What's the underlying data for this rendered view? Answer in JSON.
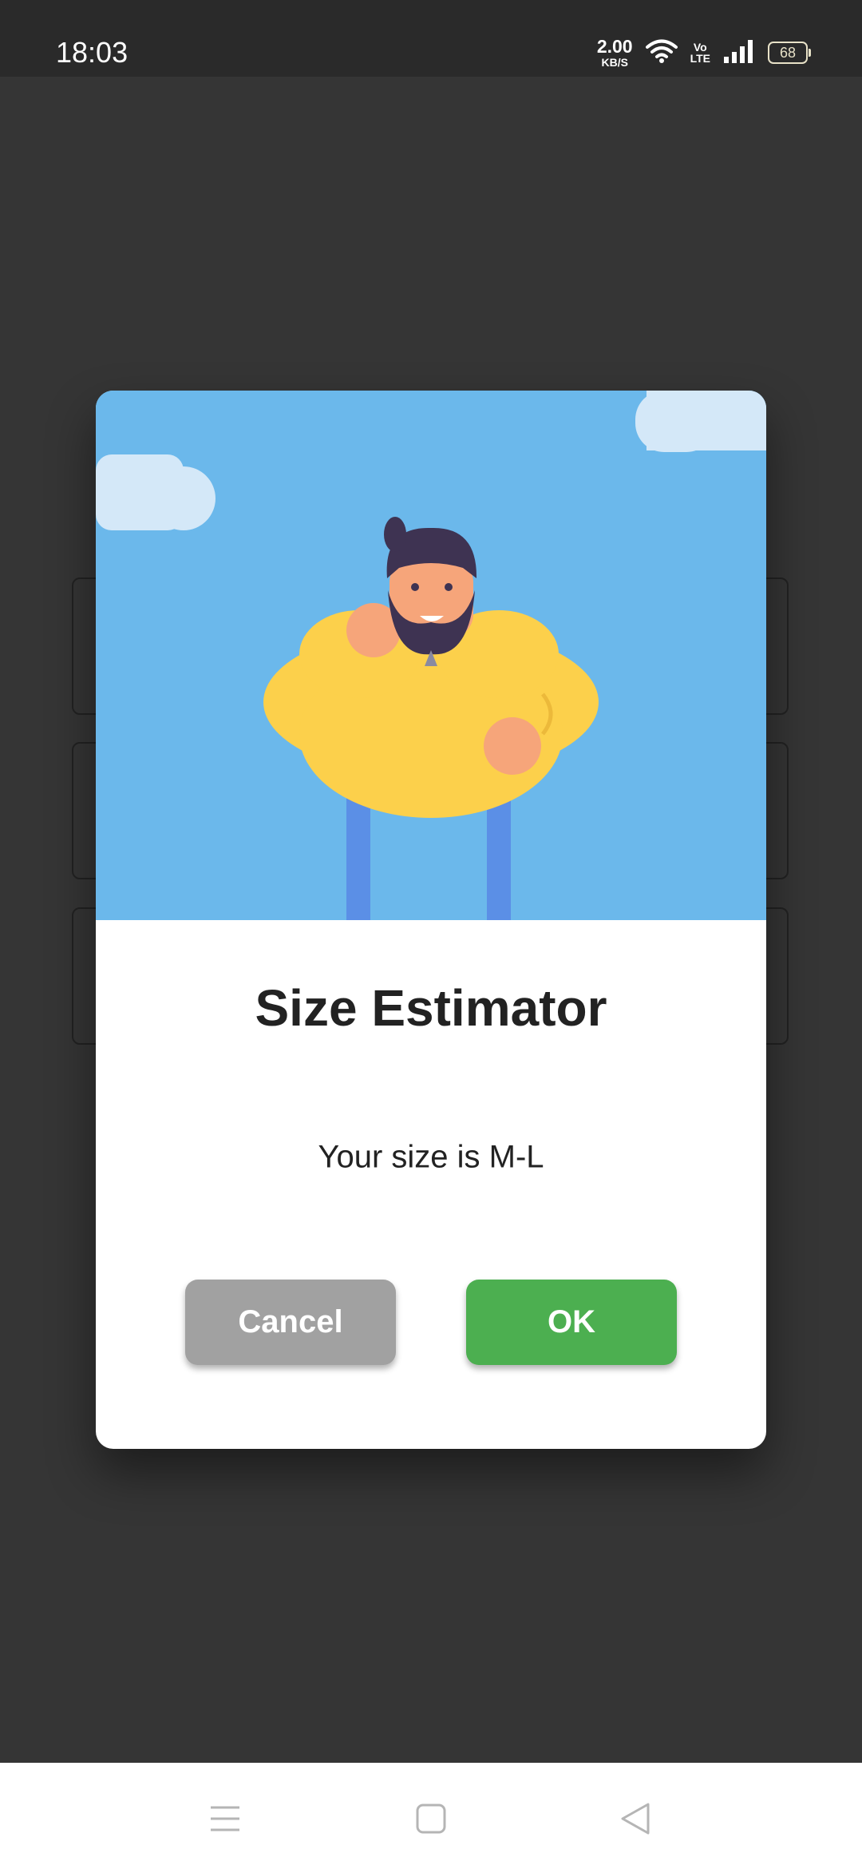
{
  "status_bar": {
    "time": "18:03",
    "net_speed_value": "2.00",
    "net_speed_unit": "KB/S",
    "volte_top": "Vo",
    "volte_bottom": "LTE",
    "battery": "68",
    "icons": [
      "wifi-icon",
      "volte-icon",
      "signal-icon",
      "battery-icon"
    ]
  },
  "dialog": {
    "title": "Size Estimator",
    "message": "Your size is M-L",
    "cancel_label": "Cancel",
    "ok_label": "OK",
    "illustration": "bearded-man-illustration"
  },
  "nav_bar": {
    "icons": [
      "menu-icon",
      "home-icon",
      "back-icon"
    ]
  },
  "colors": {
    "overlay_background": "#353535",
    "sky": "#6bb8eb",
    "cancel_button": "#a1a1a1",
    "ok_button": "#4caf50",
    "sweater": "#fcd04b",
    "jeans": "#5b8fe6"
  }
}
